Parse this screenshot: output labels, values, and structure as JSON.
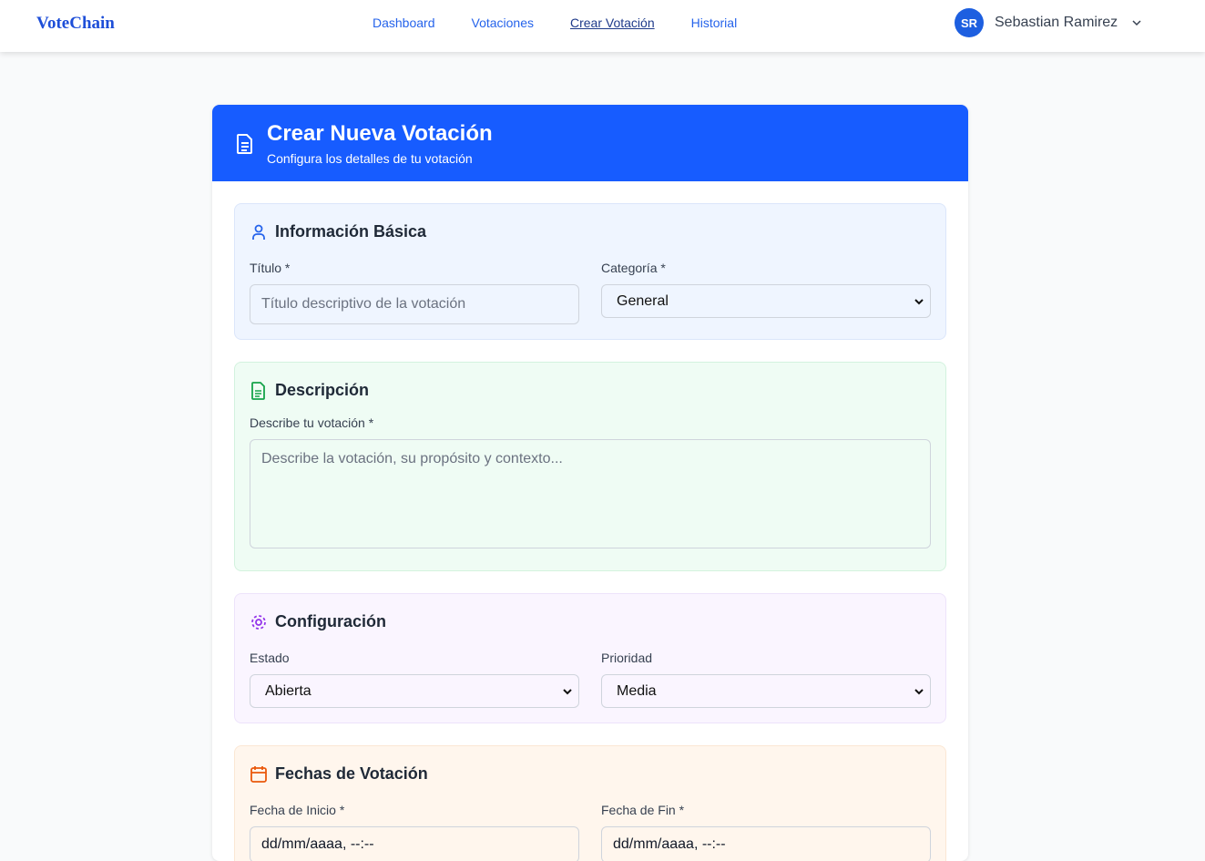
{
  "nav": {
    "logo": "VoteChain",
    "links": [
      "Dashboard",
      "Votaciones",
      "Crear Votación",
      "Historial"
    ],
    "active": "Crear Votación",
    "user_initials": "SR",
    "user_name": "Sebastian Ramirez"
  },
  "header": {
    "title": "Crear Nueva Votación",
    "subtitle": "Configura los detalles de tu votación"
  },
  "basic": {
    "title": "Información Básica",
    "titulo_label": "Título *",
    "titulo_placeholder": "Título descriptivo de la votación",
    "categoria_label": "Categoría *",
    "categoria_value": "General"
  },
  "description": {
    "title": "Descripción",
    "label": "Describe tu votación *",
    "placeholder": "Describe la votación, su propósito y contexto..."
  },
  "config": {
    "title": "Configuración",
    "estado_label": "Estado",
    "estado_value": "Abierta",
    "prioridad_label": "Prioridad",
    "prioridad_value": "Media"
  },
  "dates": {
    "title": "Fechas de Votación",
    "inicio_label": "Fecha de Inicio *",
    "fin_label": "Fecha de Fin *",
    "inicio_value": "dd/mm/aaaa, --:--",
    "fin_value": "dd/mm/aaaa, --:--"
  },
  "colors": {
    "primary": "#175cff",
    "basic_bg": "#eff5ff",
    "desc_bg": "#effcf4",
    "config_bg": "#faf5ff",
    "dates_bg": "#fff6ed"
  }
}
